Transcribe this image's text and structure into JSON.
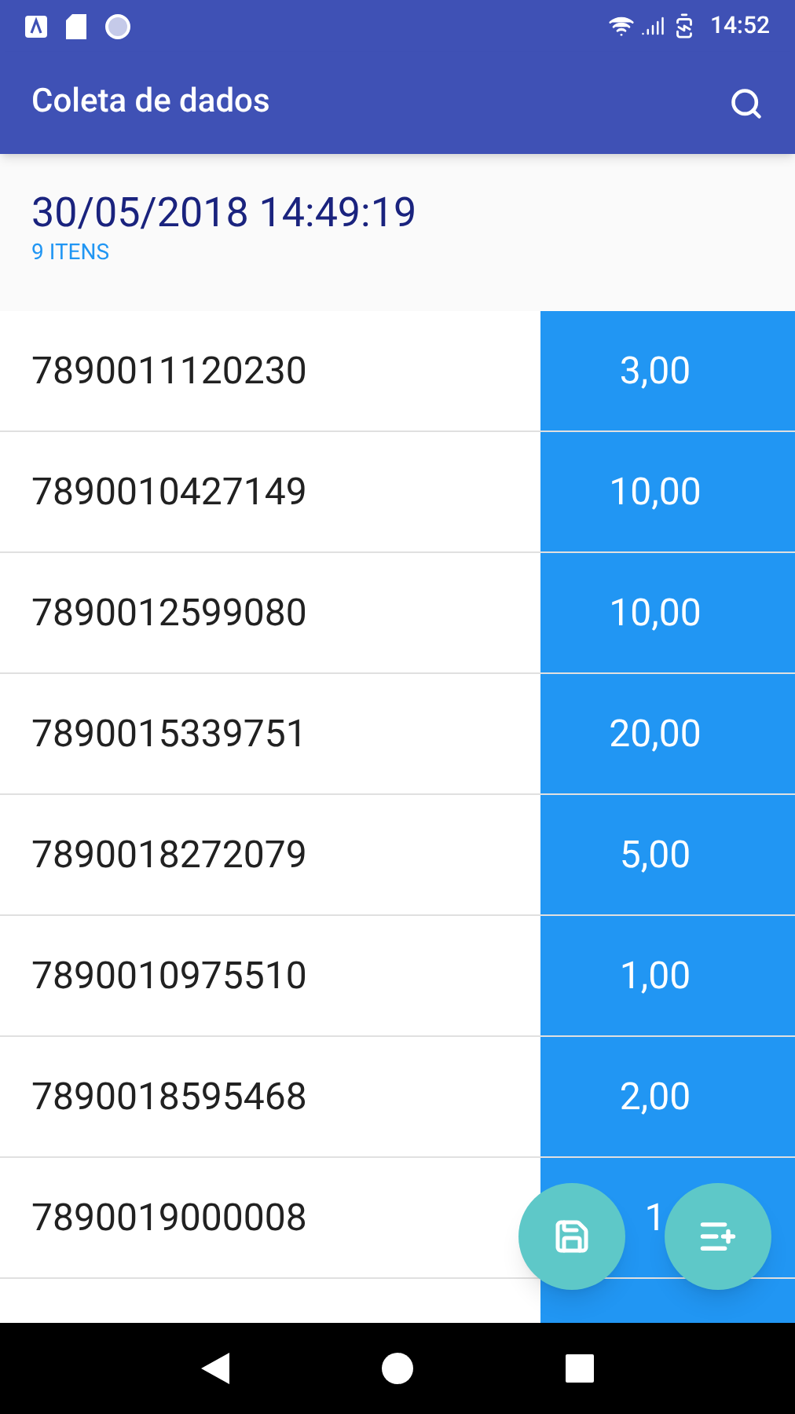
{
  "status_bar": {
    "time": "14:52"
  },
  "app_bar": {
    "title": "Coleta de dados"
  },
  "header": {
    "date": "30/05/2018 14:49:19",
    "count": "9 ITENS"
  },
  "rows": [
    {
      "code": "7890011120230",
      "quantity": "3,00"
    },
    {
      "code": "7890010427149",
      "quantity": "10,00"
    },
    {
      "code": "7890012599080",
      "quantity": "10,00"
    },
    {
      "code": "7890015339751",
      "quantity": "20,00"
    },
    {
      "code": "7890018272079",
      "quantity": "5,00"
    },
    {
      "code": "7890010975510",
      "quantity": "1,00"
    },
    {
      "code": "7890018595468",
      "quantity": "2,00"
    },
    {
      "code": "7890019000008",
      "quantity": "1"
    }
  ]
}
